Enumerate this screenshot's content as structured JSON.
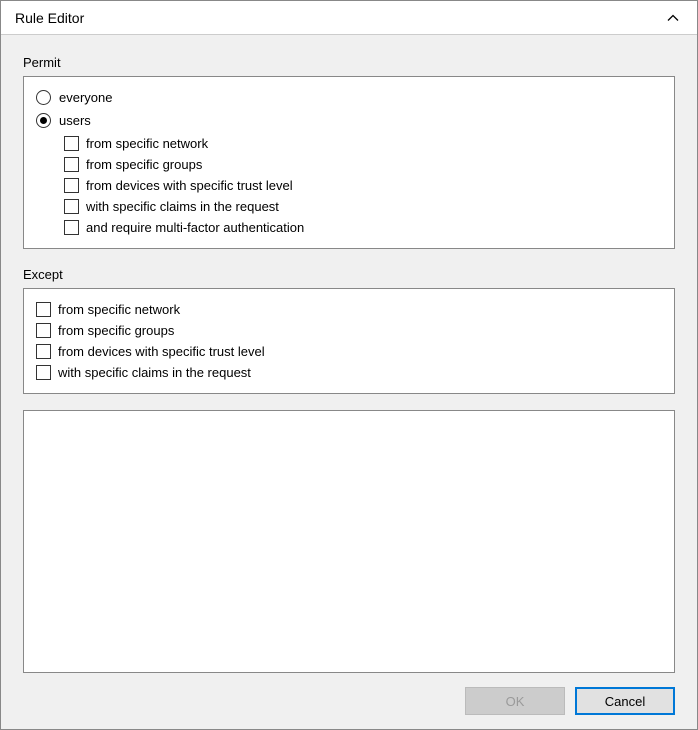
{
  "title": "Rule Editor",
  "permit": {
    "label": "Permit",
    "radios": {
      "everyone": "everyone",
      "users": "users"
    },
    "selected": "users",
    "userChecks": [
      "from specific network",
      "from specific groups",
      "from devices with specific trust level",
      "with specific claims in the request",
      "and require multi-factor authentication"
    ]
  },
  "except": {
    "label": "Except",
    "checks": [
      "from specific network",
      "from specific groups",
      "from devices with specific trust level",
      "with specific claims in the request"
    ]
  },
  "buttons": {
    "ok": "OK",
    "cancel": "Cancel"
  }
}
